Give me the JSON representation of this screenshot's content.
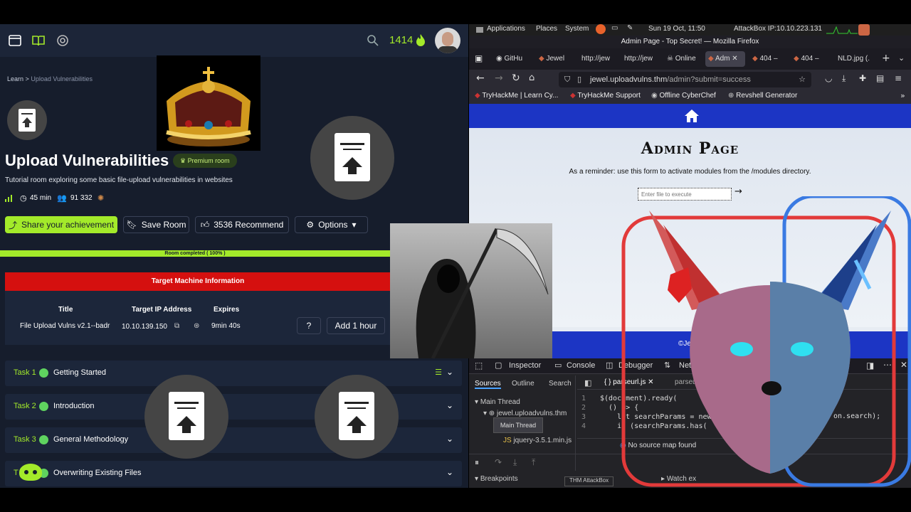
{
  "thm": {
    "points": "1414",
    "breadcrumb": {
      "learn": "Learn",
      "sep": ">",
      "current": "Upload Vulnerabilities"
    },
    "room": {
      "title": "Upload Vulnerabilities",
      "badge": "Premium room",
      "description": "Tutorial room exploring some basic file-upload vulnerabilities in websites",
      "duration": "45 min",
      "users": "91 332"
    },
    "buttons": {
      "share": "Share your achievement",
      "save": "Save Room",
      "recommend": "3536 Recommend",
      "options": "Options"
    },
    "progress": {
      "label": "Room completed ( 100% )",
      "value": 1.0
    },
    "target": {
      "header": "Target Machine Information",
      "col_title": "Title",
      "col_ip": "Target IP Address",
      "col_expires": "Expires",
      "title": "File Upload Vulns v2.1--badr",
      "ip": "10.10.139.150",
      "expires": "9min 40s",
      "help": "?",
      "add_hour": "Add 1 hour"
    },
    "tasks": [
      {
        "num": "Task 1",
        "title": "Getting Started"
      },
      {
        "num": "Task 2",
        "title": "Introduction"
      },
      {
        "num": "Task 3",
        "title": "General Methodology"
      },
      {
        "num": "T",
        "title": "Overwriting Existing Files"
      }
    ]
  },
  "desktop": {
    "menu": {
      "applications": "Applications",
      "places": "Places",
      "system": "System"
    },
    "clock": "Sun 19 Oct, 11:50",
    "attackbox": "AttackBox IP:10.10.223.131"
  },
  "firefox": {
    "window_title": "Admin Page - Top Secret! — Mozilla Firefox",
    "tabs": [
      "GitHu",
      "Jewel",
      "http://jew",
      "http://jew",
      "Online",
      "Adm",
      "404 –",
      "404 –",
      "NLD.jpg (."
    ],
    "url_host": "jewel.uploadvulns.thm",
    "url_path": "/admin?submit=success",
    "bookmarks": [
      "TryHackMe | Learn Cy...",
      "TryHackMe Support",
      "Offline CyberChef",
      "Revshell Generator"
    ]
  },
  "webpage": {
    "heading": "Admin Page",
    "reminder": "As a reminder: use this form to activate modules from the /modules directory.",
    "input_placeholder": "Enter file to execute",
    "footer": "©Jew"
  },
  "devtools": {
    "tabs": [
      "Inspector",
      "Console",
      "Debugger",
      "Network"
    ],
    "side_tabs": [
      "Sources",
      "Outline",
      "Search"
    ],
    "file_tabs": [
      "parseurl.js",
      "parseurl.js"
    ],
    "tree": {
      "main": "Main Thread",
      "host": "jewel.uploadvulns.thm",
      "jquery": "jquery-3.5.1.min.js"
    },
    "tooltip": "Main Thread",
    "code_lines": [
      "$(document).ready(",
      "  () => {",
      "    let searchParams = new",
      "    if (searchParams.has("
    ],
    "code_right": "on.search);",
    "line_numbers": [
      "1",
      "2",
      "3",
      "4"
    ],
    "no_source_map": "No source map found",
    "breakpoints": "Breakpoints",
    "watch": "Watch ex",
    "bottom_tab": "THM AttackBox"
  },
  "colors": {
    "thm_bg": "#161d2c",
    "accent_green": "#a3ea2a",
    "danger_red": "#d5100f",
    "admin_blue": "#1c35c4"
  },
  "icons": [
    "window-icon",
    "book-icon",
    "target-icon",
    "search-icon",
    "fire-icon",
    "avatar",
    "crown-image",
    "reaper-image",
    "upload-file-icon",
    "fox-image",
    "home-icon"
  ]
}
